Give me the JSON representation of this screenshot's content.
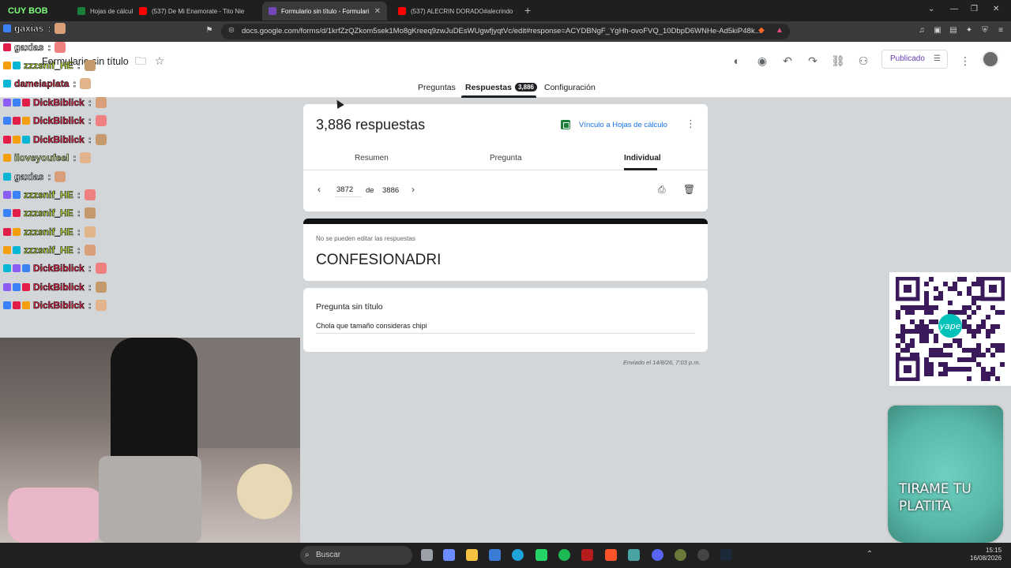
{
  "browser": {
    "tabs": [
      {
        "label": "Hojas de cálcul",
        "active": false
      },
      {
        "label": "(537) De Mi Enamorate - Tito Nie",
        "active": false
      },
      {
        "label": "Formulario sin título - Formulari",
        "active": true
      },
      {
        "label": "(537) ALECRIN DORADO#alecrindo",
        "active": false
      }
    ],
    "url": "docs.google.com/forms/d/1krfZzQZkom5sek1Mo8gKreeq9zwJuDEsWUgwfjyqtVc/edit#response=ACYDBNgF_YgHh-ovoFVQ_10DbpD6WNHe-Ad5kiP48k..."
  },
  "form": {
    "title": "Formulario sin título",
    "publish_label": "Publicado",
    "nav_tabs": {
      "preguntas": "Preguntas",
      "respuestas": "Respuestas",
      "resp_count": "3,886",
      "configuracion": "Configuración"
    }
  },
  "responses": {
    "count_label": "3,886 respuestas",
    "sheets_link": "Vínculo a Hojas de cálculo",
    "subtabs": {
      "resumen": "Resumen",
      "pregunta": "Pregunta",
      "individual": "Individual"
    },
    "pager": {
      "current": "3872",
      "de": "de",
      "total": "3886"
    }
  },
  "response_card": {
    "noedit": "No se pueden editar las respuestas",
    "name": "CONFESIONADRI"
  },
  "question_card": {
    "title": "Pregunta sin título",
    "answer": "Chola que tamaño consideras chipi"
  },
  "sent": "Enviado el 14/8/26, 7:03 p.m.",
  "chat": [
    {
      "user": "gaxias",
      "color": "#ffffff"
    },
    {
      "user": "gaxias",
      "color": "#ffffff"
    },
    {
      "user": "zzzsnif_HE",
      "color": "#c6f33a"
    },
    {
      "user": "dameiaplata",
      "color": "#e0334f"
    },
    {
      "user": "DickBiblick",
      "color": "#ff2d55"
    },
    {
      "user": "DickBiblick",
      "color": "#ff2d55"
    },
    {
      "user": "DickBiblick",
      "color": "#ff2d55"
    },
    {
      "user": "iloveyoufeel",
      "color": "#e8f5a0"
    },
    {
      "user": "gaxias",
      "color": "#ffffff"
    },
    {
      "user": "zzzsnif_HE",
      "color": "#c6f33a"
    },
    {
      "user": "zzzsnif_HE",
      "color": "#c6f33a"
    },
    {
      "user": "zzzsnif_HE",
      "color": "#c6f33a"
    },
    {
      "user": "zzzsnif_HE",
      "color": "#c6f33a"
    },
    {
      "user": "DickBiblick",
      "color": "#ff2d55"
    },
    {
      "user": "DickBiblick",
      "color": "#ff2d55"
    },
    {
      "user": "DickBiblick",
      "color": "#ff2d55"
    }
  ],
  "overlay": {
    "top_label": "CUY BOB",
    "jar_text": "TIRAME TU PLATITA",
    "qr_brand": "yape"
  },
  "taskbar": {
    "search": "Buscar",
    "time": "15:15",
    "date": "16/08/2026"
  }
}
